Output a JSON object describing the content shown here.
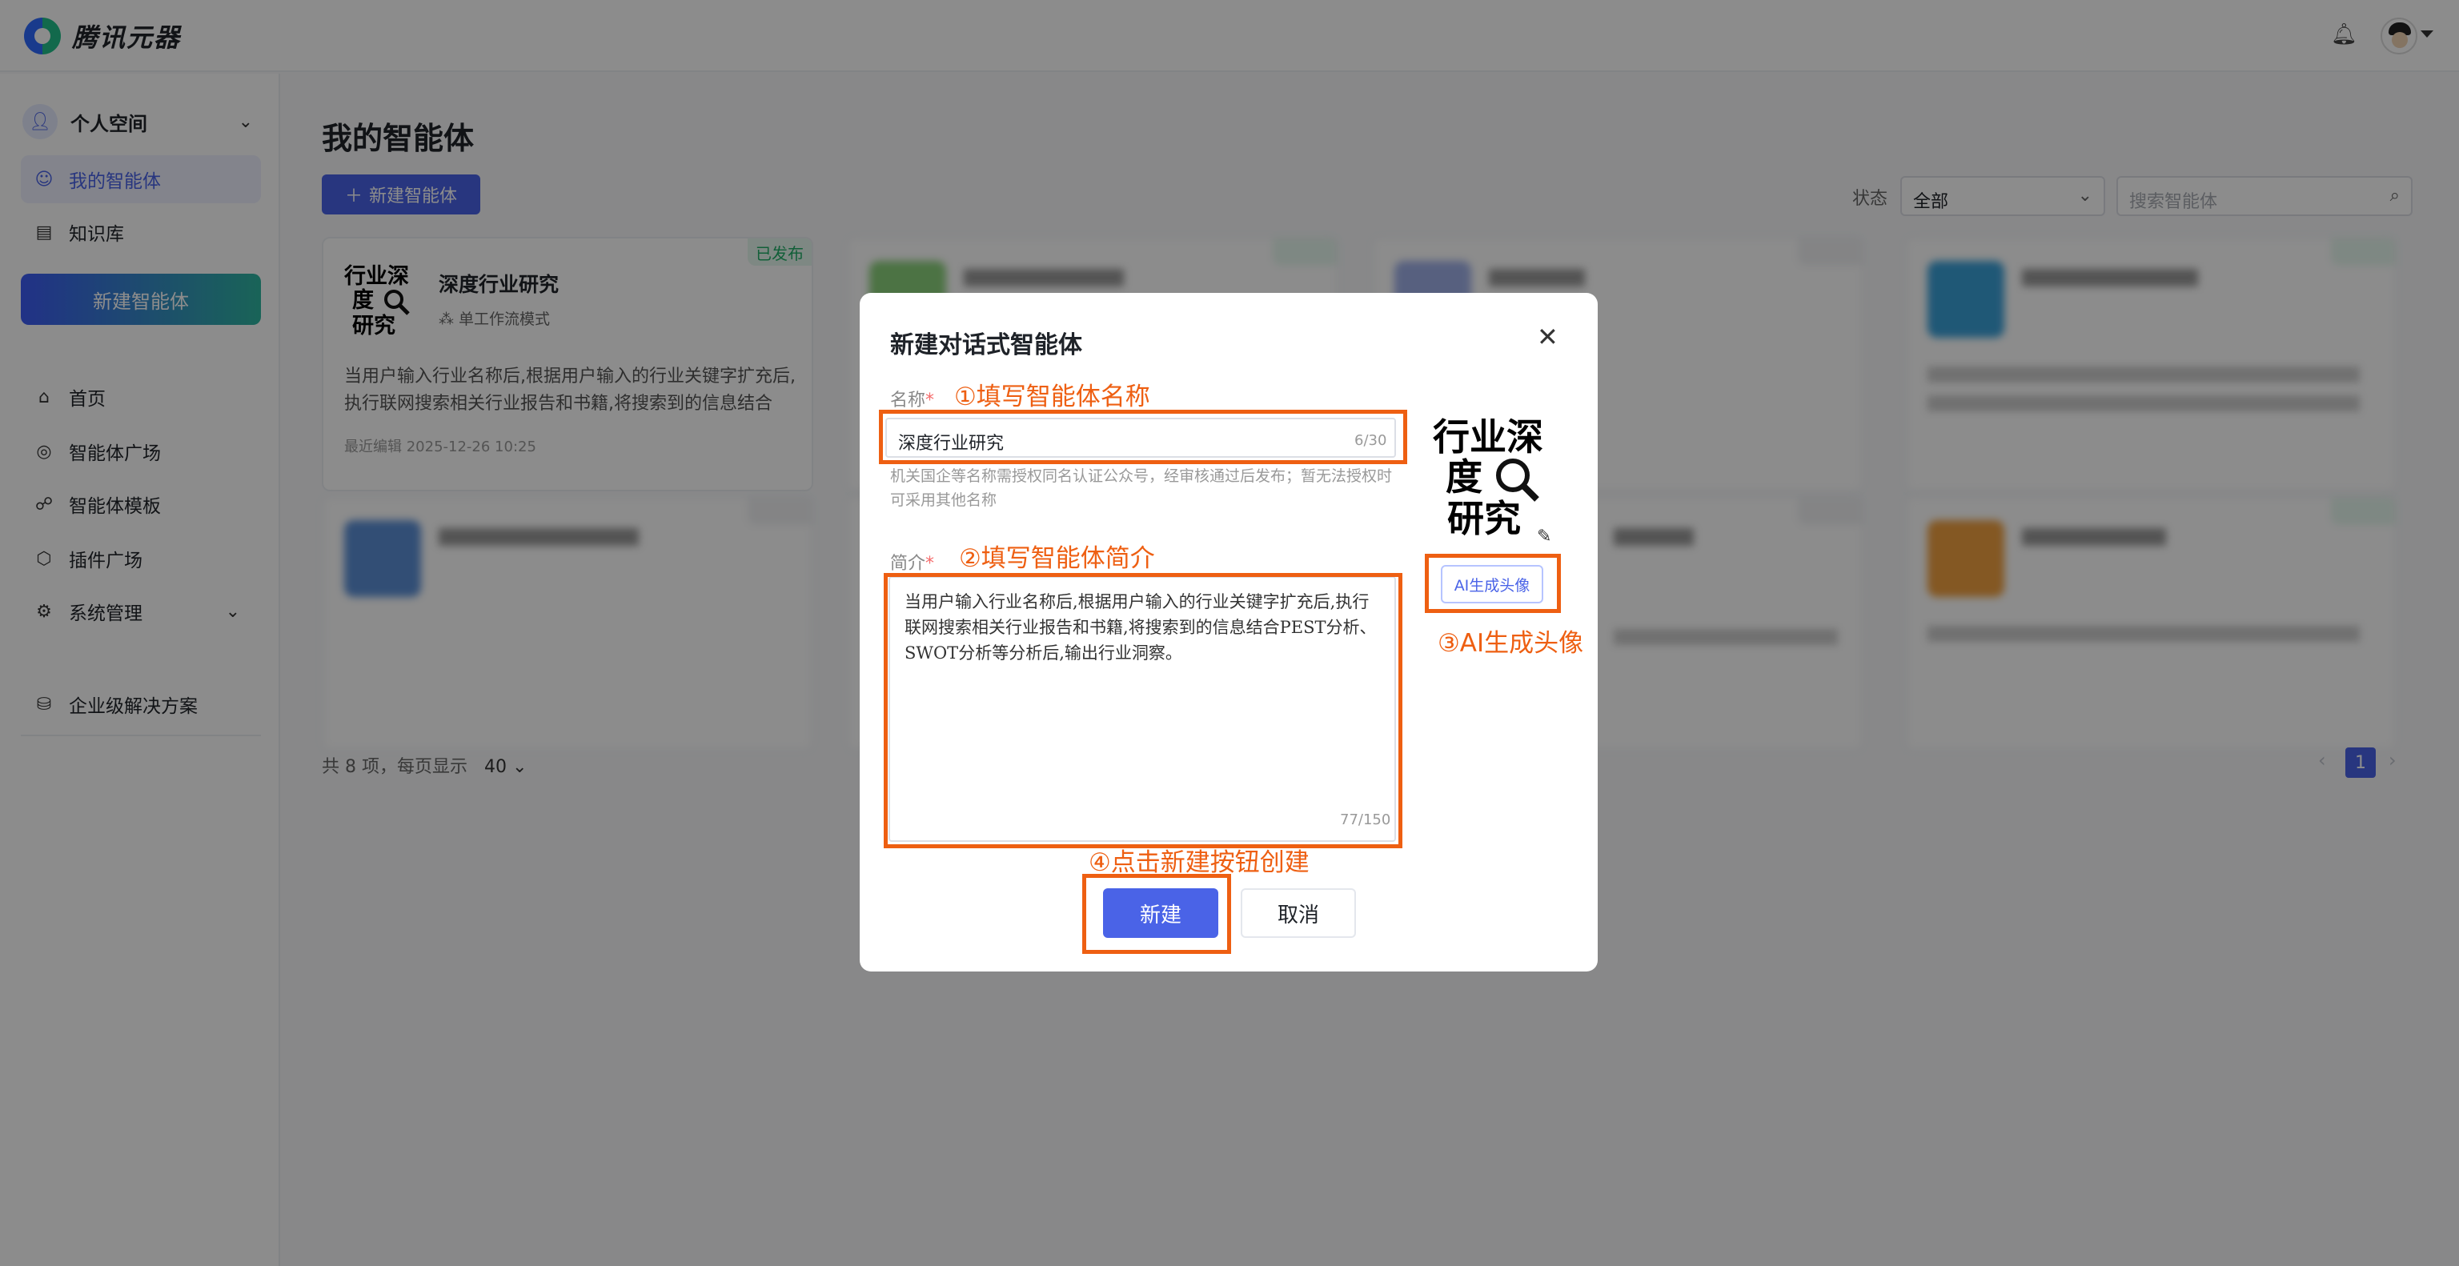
{
  "app": {
    "name": "腾讯元器"
  },
  "sidebar": {
    "space_label": "个人空间",
    "items": [
      {
        "label": "我的智能体",
        "icon": "robot-icon"
      },
      {
        "label": "知识库",
        "icon": "document-icon"
      }
    ],
    "new_agent_label": "新建智能体",
    "nav": [
      {
        "label": "首页",
        "icon": "home-icon"
      },
      {
        "label": "智能体广场",
        "icon": "plaza-icon"
      },
      {
        "label": "智能体模板",
        "icon": "template-icon"
      },
      {
        "label": "插件广场",
        "icon": "plugin-icon"
      },
      {
        "label": "系统管理",
        "icon": "gear-icon"
      }
    ],
    "enterprise_label": "企业级解决方案"
  },
  "main": {
    "title": "我的智能体",
    "create_label": "新建智能体",
    "status_label": "状态",
    "status_value": "全部",
    "search_placeholder": "搜索智能体",
    "cards": [
      {
        "title": "深度行业研究",
        "mode": "单工作流模式",
        "desc": "当用户输入行业名称后,根据用户输入的行业关键字扩充后,执行联网搜索相关行业报告和书籍,将搜索到的信息结合P...",
        "time": "最近编辑 2025-12-26 10:25",
        "badge": "已发布",
        "thumb": "行业深度研究",
        "blurred": false
      },
      {
        "title": "",
        "mode": "",
        "desc": "",
        "time": "",
        "badge": "",
        "thumb": "",
        "blurred": true
      },
      {
        "title": "",
        "mode": "",
        "desc": "",
        "time": "",
        "badge": "",
        "thumb": "",
        "blurred": true
      },
      {
        "title": "",
        "mode": "",
        "desc": "",
        "time": "",
        "badge": "",
        "thumb": "",
        "blurred": true
      },
      {
        "title": "",
        "mode": "",
        "desc": "",
        "time": "",
        "badge": "",
        "thumb": "",
        "blurred": true
      },
      {
        "title": "",
        "mode": "",
        "desc": "",
        "time": "",
        "badge": "",
        "thumb": "",
        "blurred": true
      },
      {
        "title": "",
        "mode": "",
        "desc": "",
        "time": "",
        "badge": "",
        "thumb": "",
        "blurred": true
      },
      {
        "title": "",
        "mode": "",
        "desc": "",
        "time": "",
        "badge": "",
        "thumb": "",
        "blurred": true
      }
    ],
    "total_text": "共 8 项，每页显示",
    "page_size": "40",
    "current_page": "1"
  },
  "modal": {
    "title": "新建对话式智能体",
    "name_label": "名称",
    "name_value": "深度行业研究",
    "name_counter": "6/30",
    "name_hint": "机关国企等名称需授权同名认证公众号，经审核通过后发布；暂无法授权时可采用其他名称",
    "intro_label": "简介",
    "intro_value": "当用户输入行业名称后,根据用户输入的行业关键字扩充后,执行联网搜索相关行业报告和书籍,将搜索到的信息结合PEST分析、SWOT分析等分析后,输出行业洞察。",
    "intro_counter": "77/150",
    "avatar_text": "行业深度研究",
    "ai_avatar_label": "AI生成头像",
    "submit_label": "新建",
    "cancel_label": "取消"
  },
  "annotations": {
    "step1": "①填写智能体名称",
    "step2": "②填写智能体简介",
    "step3": "③AI生成头像",
    "step4": "④点击新建按钮创建"
  },
  "colors": {
    "accent": "#4a63e7",
    "annotation": "#ee5f12",
    "published": "#1fae67"
  }
}
